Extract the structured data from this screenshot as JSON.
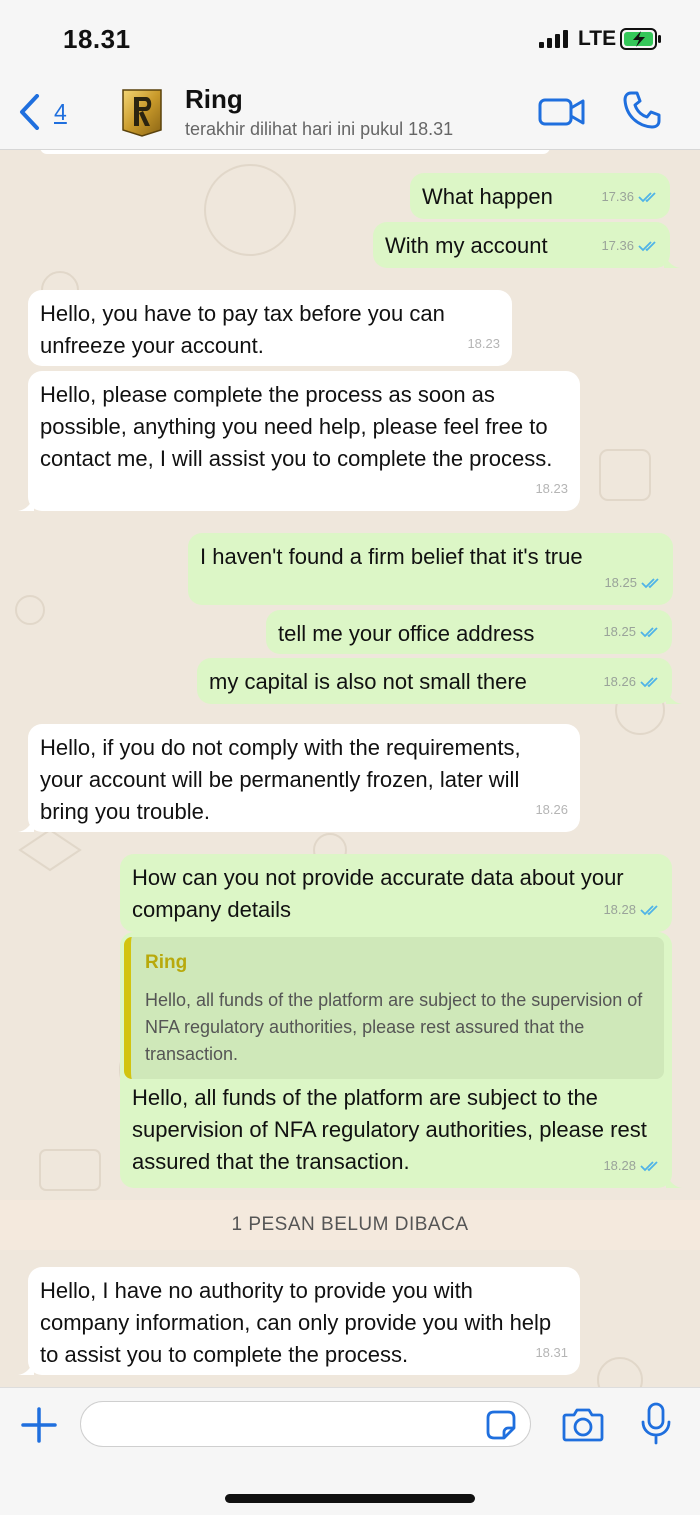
{
  "status_bar": {
    "time": "18.31",
    "network": "LTE"
  },
  "header": {
    "back_count": "4",
    "contact_name": "Ring",
    "last_seen": "terakhir dilihat hari ini pukul 18.31"
  },
  "messages": [
    {
      "direction": "out",
      "text": "What happen",
      "time": "17.36",
      "read": true
    },
    {
      "direction": "out",
      "text": "With my account",
      "time": "17.36",
      "read": true
    },
    {
      "direction": "in",
      "text": "Hello, you have to pay tax before you can unfreeze your account.",
      "time": "18.23"
    },
    {
      "direction": "in",
      "text": "Hello, please complete the process as soon as possible, anything you need help, please feel free to contact me, I will assist you to complete the process.",
      "time": "18.23"
    },
    {
      "direction": "out",
      "text": "I haven't found a firm belief that it's true",
      "time": "18.25",
      "read": true
    },
    {
      "direction": "out",
      "text": "tell me your office address",
      "time": "18.25",
      "read": true
    },
    {
      "direction": "out",
      "text": "my capital is also not small there",
      "time": "18.26",
      "read": true
    },
    {
      "direction": "in",
      "text": "Hello, if you do not comply with the requirements, your account will be permanently frozen, later will bring you trouble.",
      "time": "18.26"
    },
    {
      "direction": "out",
      "text": "How can you not provide accurate data about your company details",
      "time": "18.28",
      "read": true
    },
    {
      "direction": "out",
      "quoted": {
        "sender": "Ring",
        "text": "Hello, all funds of the platform are subject to the supervision of NFA regulatory authorities, please rest assured that the transaction."
      },
      "text": "Hello, all funds of the platform are subject to the supervision of NFA regulatory authorities, please rest assured that the transaction.",
      "time": "18.28",
      "read": true
    },
    {
      "direction": "in",
      "text": "Hello, I have no authority to provide you with company information, can only provide you with help to assist you to complete the process.",
      "time": "18.31"
    }
  ],
  "unread_banner": "1 PESAN BELUM DIBACA",
  "input": {
    "value": "",
    "placeholder": ""
  },
  "colors": {
    "accent": "#1f6fde",
    "outgoing_bubble": "#dcf6c6",
    "incoming_bubble": "#ffffff",
    "read_ticks": "#4fb3e8",
    "quote_bar": "#d2c410",
    "chat_background": "#efe7dc"
  },
  "icons": [
    "back-chevron-icon",
    "avatar-logo",
    "video-call-icon",
    "phone-icon",
    "read-ticks-icon",
    "plus-icon",
    "sticker-icon",
    "camera-icon",
    "microphone-icon"
  ]
}
